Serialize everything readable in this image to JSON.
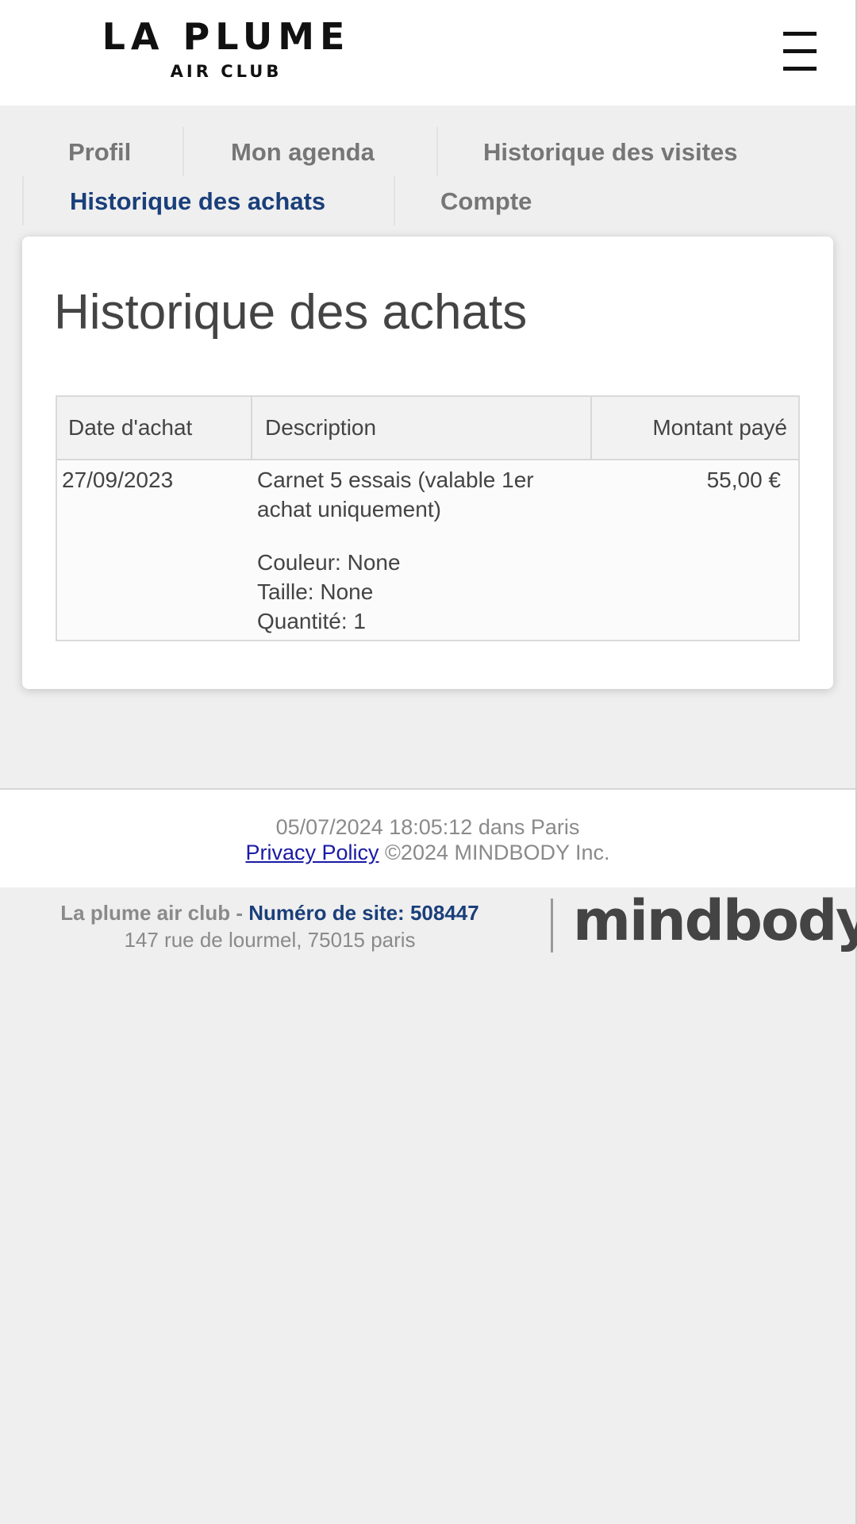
{
  "header": {
    "logo_main": "LA PLUME",
    "logo_sub": "AIR CLUB",
    "menu_icon": "hamburger-icon"
  },
  "tabs": [
    {
      "label": "Profil",
      "active": false
    },
    {
      "label": "Mon agenda",
      "active": false
    },
    {
      "label": "Historique des visites",
      "active": false
    },
    {
      "label": "Historique des achats",
      "active": true
    },
    {
      "label": "Compte",
      "active": false
    }
  ],
  "main": {
    "title": "Historique des achats",
    "table": {
      "headers": [
        "Date d'achat",
        "Description",
        "Montant payé"
      ],
      "rows": [
        {
          "date": "27/09/2023",
          "description_line1": "Carnet 5 essais (valable 1er",
          "description_line2": "achat uniquement)",
          "color": "Couleur: None",
          "size": "Taille: None",
          "quantity": "Quantité: 1",
          "amount": "55,00 €"
        }
      ]
    }
  },
  "footer": {
    "timestamp": "05/07/2024 18:05:12 dans Paris",
    "privacy_link": "Privacy Policy",
    "copyright": "©2024 MINDBODY Inc.",
    "site_name": "La plume air club - ",
    "site_number": "Numéro de site: 508447",
    "address": "147 rue de lourmel, 75015 paris",
    "brand_logo": "mindbody"
  },
  "colors": {
    "accent": "#1a3f7a",
    "background": "#efefef",
    "link": "#1a1aa6"
  }
}
